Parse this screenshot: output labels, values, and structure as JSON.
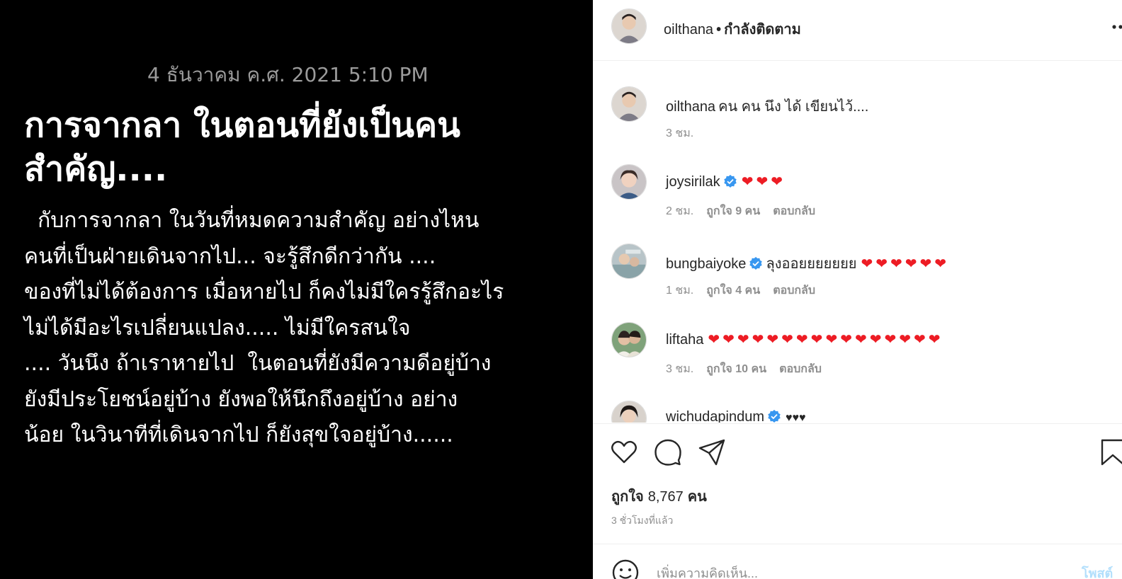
{
  "post_image": {
    "date": "4 ธันวาคม ค.ศ. 2021 5:10 PM",
    "title_lines": [
      "การจากลา ในตอนที่ยังเป็นคน",
      "สำคัญ...."
    ],
    "body_lines": [
      "  กับการจากลา ในวันที่หมดความสำคัญ อย่างไหน",
      "คนที่เป็นฝ่ายเดินจากไป... จะรู้สึกดีกว่ากัน ....",
      "ของที่ไม่ได้ต้องการ เมื่อหายไป ก็คงไม่มีใครรู้สึกอะไร",
      "ไม่ได้มีอะไรเปลี่ยนแปลง..... ไม่มีใครสนใจ",
      ".... วันนึง ถ้าเราหายไป  ในตอนที่ยังมีความดีอยู่บ้าง",
      "ยังมีประโยชน์อยู่บ้าง ยังพอให้นึกถึงอยู่บ้าง อย่าง",
      "น้อย ในวินาทีที่เดินจากไป ก็ยังสุขใจอยู่บ้าง......"
    ]
  },
  "header": {
    "username": "oilthana",
    "separator": "•",
    "follow_status": "กำลังติดตาม",
    "more_icon": "more-dots-icon"
  },
  "caption": {
    "username": "oilthana",
    "text": "คน คน นึง ได้ เขียนไว้....",
    "time": "3 ชม."
  },
  "comments": [
    {
      "username": "joysirilak",
      "verified": true,
      "text": "",
      "hearts": "❤❤❤",
      "time": "2 ชม.",
      "likes": "ถูกใจ 9 คน",
      "reply": "ตอบกลับ"
    },
    {
      "username": "bungbaiyoke",
      "verified": true,
      "text": "ลุงออยยยยยยย",
      "hearts": "❤❤❤❤❤❤",
      "time": "1 ชม.",
      "likes": "ถูกใจ 4 คน",
      "reply": "ตอบกลับ"
    },
    {
      "username": "liftaha",
      "verified": false,
      "text": "",
      "hearts": "❤❤❤❤❤❤❤❤❤❤❤❤❤❤❤❤",
      "time": "3 ชม.",
      "likes": "ถูกใจ 10 คน",
      "reply": "ตอบกลับ"
    },
    {
      "username": "wichudapindum",
      "verified": true,
      "text": "",
      "hearts": "♥♥♥",
      "time": "",
      "likes": "",
      "reply": ""
    }
  ],
  "actions": {
    "like_icon": "heart-icon",
    "comment_icon": "comment-bubble-icon",
    "share_icon": "paper-plane-icon",
    "save_icon": "bookmark-icon",
    "likes_label": "ถูกใจ",
    "likes_count": "8,767",
    "likes_unit": "คน",
    "time_ago": "3 ชั่วโมงที่แล้ว"
  },
  "add_comment": {
    "placeholder": "เพิ่มความคิดเห็น...",
    "post_label": "โพสต์"
  },
  "colors": {
    "image_bg": "#000000",
    "date_gray": "#9b9b9b",
    "verified_blue": "#3897f0",
    "heart_red": "#ed1c24",
    "meta_gray": "#8e8e8e",
    "border": "#efefef"
  }
}
